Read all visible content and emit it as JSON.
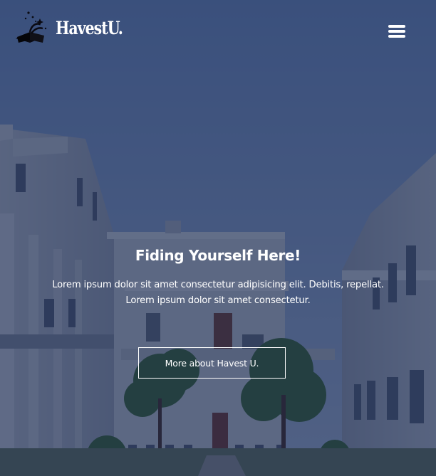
{
  "brand": {
    "name": "HavestU.",
    "icon": "book-stars-icon"
  },
  "nav": {
    "menu_icon": "hamburger-menu-icon"
  },
  "hero": {
    "title": "Fiding Yourself Here!",
    "text_line1": "Lorem ipsum dolor sit amet consectetur adipisicing elit. Debitis, repellat.",
    "text_line2": "Lorem ipsum dolor sit amet consectetur.",
    "button_label": "More about Havest U.",
    "background_image": "campus-courtyard-building-photo"
  },
  "colors": {
    "overlay": "#0a1c46",
    "text": "#ffffff"
  }
}
